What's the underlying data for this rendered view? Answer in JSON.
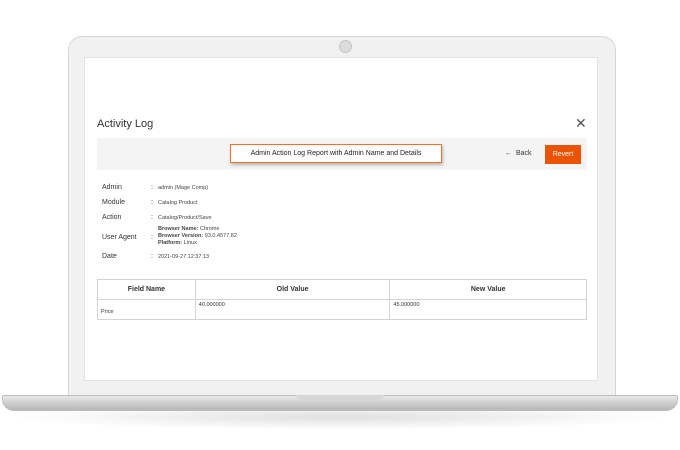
{
  "dialog": {
    "title": "Activity Log",
    "close_glyph": "✕"
  },
  "toolbar": {
    "callout": "Admin Action Log Report with Admin Name and Details",
    "back_label": "Back",
    "back_glyph": "←",
    "revert_label": "Revert"
  },
  "details": {
    "admin": {
      "label": "Admin",
      "value": "admin (Mage Comp)"
    },
    "module": {
      "label": "Module",
      "value": "Catalog Product"
    },
    "action": {
      "label": "Action",
      "value": "Catalog/Product/Save"
    },
    "user_agent": {
      "label": "User Agent",
      "browser_name_label": "Browser Name:",
      "browser_name": "Chrome",
      "browser_version_label": "Browser Version:",
      "browser_version": "93.0.4577.82",
      "platform_label": "Platform:",
      "platform": "Linux"
    },
    "date": {
      "label": "Date",
      "value": "2021-09-27 12:37:13"
    },
    "colon": ":"
  },
  "table": {
    "headers": [
      "Field Name",
      "Old Value",
      "New Value"
    ],
    "rows": [
      [
        "Price",
        "40.000000",
        "45.000000"
      ]
    ]
  },
  "colors": {
    "accent": "#eb5202",
    "callout_border": "#f37021"
  }
}
